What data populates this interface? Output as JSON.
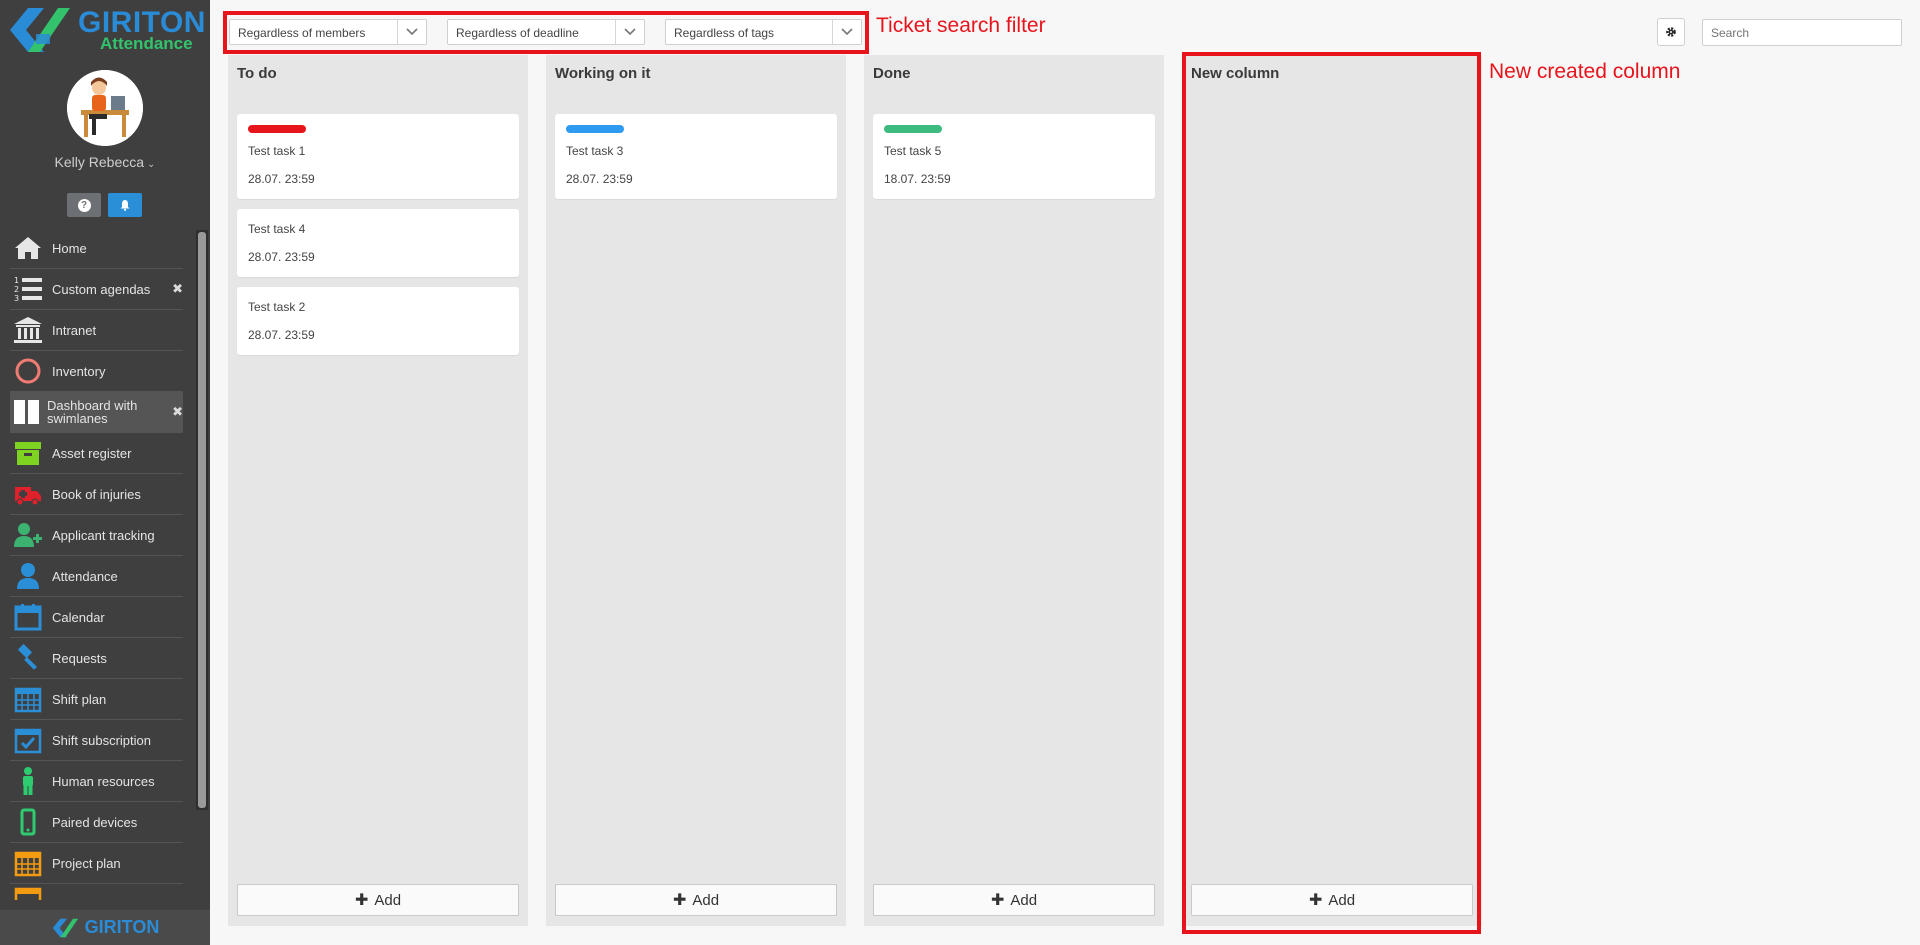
{
  "sidebar": {
    "brand_name": "GIRITON",
    "brand_sub": "Attendance",
    "user_name": "Kelly Rebecca",
    "help_icon": "?",
    "footer_brand": "GIRITON",
    "items": [
      {
        "label": "Home",
        "icon": "home-icon",
        "color": "#e6e6e6"
      },
      {
        "label": "Custom agendas",
        "icon": "numbered-list-icon",
        "color": "#e6e6e6",
        "closable": true
      },
      {
        "label": "Intranet",
        "icon": "bank-icon",
        "color": "#e6e6e6"
      },
      {
        "label": "Inventory",
        "icon": "circle-icon",
        "color": "#f07b72"
      },
      {
        "label": "Dashboard with swimlanes",
        "icon": "columns-icon",
        "color": "#ffffff",
        "closable": true,
        "active": true
      },
      {
        "label": "Asset register",
        "icon": "archive-box-icon",
        "color": "#7ed321"
      },
      {
        "label": "Book of injuries",
        "icon": "ambulance-icon",
        "color": "#e0212b"
      },
      {
        "label": "Applicant tracking",
        "icon": "add-user-icon",
        "color": "#3cb371"
      },
      {
        "label": "Attendance",
        "icon": "user-icon",
        "color": "#2b8fd8"
      },
      {
        "label": "Calendar",
        "icon": "calendar-icon",
        "color": "#2b8fd8"
      },
      {
        "label": "Requests",
        "icon": "gavel-icon",
        "color": "#2b8fd8"
      },
      {
        "label": "Shift plan",
        "icon": "calendar-grid-icon",
        "color": "#2b8fd8"
      },
      {
        "label": "Shift subscription",
        "icon": "calendar-check-icon",
        "color": "#2b8fd8"
      },
      {
        "label": "Human resources",
        "icon": "person-icon",
        "color": "#2ecc71"
      },
      {
        "label": "Paired devices",
        "icon": "mobile-phone-icon",
        "color": "#2ecc71"
      },
      {
        "label": "Project plan",
        "icon": "calendar-grid-icon",
        "color": "#f39c12"
      }
    ]
  },
  "filters": {
    "members": "Regardless of members",
    "deadline": "Regardless of deadline",
    "tags": "Regardless of tags"
  },
  "annotations": {
    "filter_label": "Ticket search filter",
    "column_label": "New created column",
    "color": "#e8141b"
  },
  "search": {
    "placeholder": "Search"
  },
  "add_label": "Add",
  "columns": [
    {
      "title": "To do",
      "cards": [
        {
          "title": "Test task 1",
          "date": "28.07. 23:59",
          "tag_color": "#e8141b"
        },
        {
          "title": "Test task 4",
          "date": "28.07. 23:59"
        },
        {
          "title": "Test task 2",
          "date": "28.07. 23:59"
        }
      ]
    },
    {
      "title": "Working on it",
      "cards": [
        {
          "title": "Test task 3",
          "date": "28.07. 23:59",
          "tag_color": "#2e9af0"
        }
      ]
    },
    {
      "title": "Done",
      "cards": [
        {
          "title": "Test task 5",
          "date": "18.07. 23:59",
          "tag_color": "#3dbb7e"
        }
      ]
    },
    {
      "title": "New column",
      "cards": []
    }
  ]
}
